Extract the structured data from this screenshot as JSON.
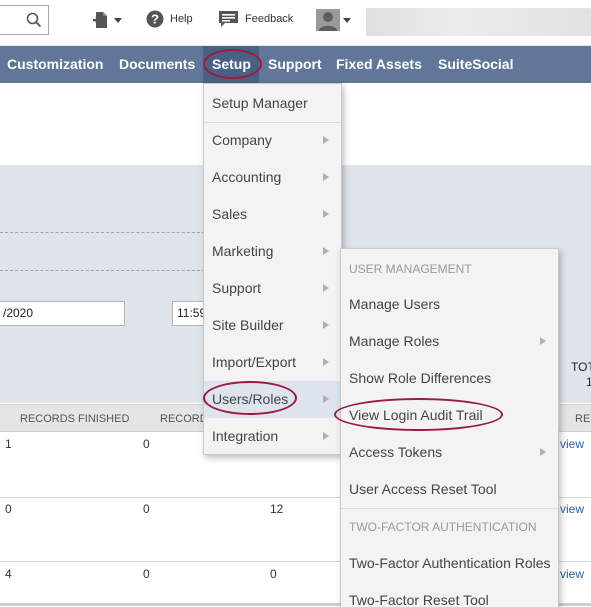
{
  "topbar": {
    "help_label": "Help",
    "feedback_label": "Feedback",
    "icons": [
      "search-icon",
      "new-document-icon",
      "help-icon",
      "feedback-icon",
      "user-avatar-icon"
    ]
  },
  "nav": {
    "items": [
      "Customization",
      "Documents",
      "Setup",
      "Support",
      "Fixed Assets",
      "SuiteSocial"
    ],
    "active": "Setup"
  },
  "filters": {
    "date_value": "/2020",
    "time_value": "11:59"
  },
  "summary": {
    "total_label": "TOT",
    "total_value": "1"
  },
  "table": {
    "headers": [
      "RECORDS FINISHED",
      "RECORD",
      "RE"
    ],
    "rows": [
      {
        "finished": "1",
        "records": "0",
        "extra": "",
        "link": "view"
      },
      {
        "finished": "0",
        "records": "0",
        "extra": "12",
        "link": "view"
      },
      {
        "finished": "4",
        "records": "0",
        "extra": "0",
        "link": "view"
      }
    ]
  },
  "setup_menu": {
    "items": [
      {
        "label": "Setup Manager",
        "submenu": false
      },
      {
        "label": "Company",
        "submenu": true
      },
      {
        "label": "Accounting",
        "submenu": true
      },
      {
        "label": "Sales",
        "submenu": true
      },
      {
        "label": "Marketing",
        "submenu": true
      },
      {
        "label": "Support",
        "submenu": true
      },
      {
        "label": "Site Builder",
        "submenu": true
      },
      {
        "label": "Import/Export",
        "submenu": true
      },
      {
        "label": "Users/Roles",
        "submenu": true,
        "highlighted": true
      },
      {
        "label": "Integration",
        "submenu": true
      }
    ]
  },
  "users_menu": {
    "section_user_management": "USER MANAGEMENT",
    "items": [
      {
        "label": "Manage Users",
        "submenu": false
      },
      {
        "label": "Manage Roles",
        "submenu": true
      },
      {
        "label": "Show Role Differences",
        "submenu": false
      },
      {
        "label": "View Login Audit Trail",
        "submenu": false
      },
      {
        "label": "Access Tokens",
        "submenu": true
      },
      {
        "label": "User Access Reset Tool",
        "submenu": false
      }
    ],
    "section_two_factor": "TWO-FACTOR AUTHENTICATION",
    "two_factor_items": [
      {
        "label": "Two-Factor Authentication Roles",
        "submenu": false
      },
      {
        "label": "Two-Factor Reset Tool",
        "submenu": false
      }
    ]
  },
  "colors": {
    "nav_bg": "#607799",
    "nav_active": "#4a6185",
    "highlight_ring": "#9b1b3d",
    "menu_bg": "#f3f3f3",
    "menu_hover": "#dde4ee",
    "filter_panel": "#dfe4eb",
    "link": "#2961a7"
  }
}
